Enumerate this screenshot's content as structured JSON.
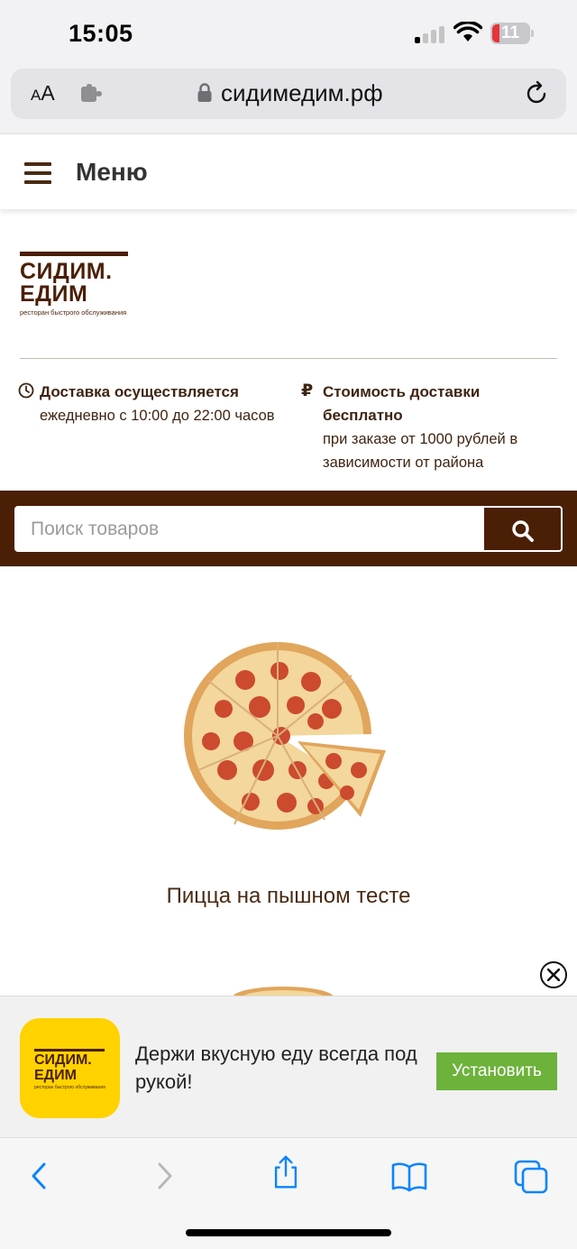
{
  "status_bar": {
    "time": "15:05",
    "battery_level": "11",
    "signal_bars_active": 1,
    "icons": [
      "cellular-signal-icon",
      "wifi-icon",
      "battery-icon"
    ]
  },
  "browser": {
    "text_size_label": "AA",
    "url": "сидимедим.рф",
    "icons": [
      "puzzle-icon",
      "lock-icon",
      "reload-icon"
    ]
  },
  "site_header": {
    "menu_label": "Меню",
    "icons": [
      "hamburger-icon"
    ]
  },
  "logo": {
    "line1": "СИДИМ.",
    "line2": "ЕДИМ",
    "tagline": "ресторан быстрого обслуживания"
  },
  "delivery_info": {
    "title": "Доставка осуществляется",
    "text": "ежедневно с 10:00 до 22:00 часов",
    "icon": "clock-icon"
  },
  "price_info": {
    "symbol": "₽",
    "title": "Стоимость доставки бесплатно",
    "text": "при заказе от 1000 рублей в зависимости от района"
  },
  "search": {
    "placeholder": "Поиск товаров",
    "icon": "search-icon"
  },
  "product": {
    "title": "Пицца на пышном тесте",
    "image": "pepperoni-pizza"
  },
  "app_banner": {
    "icon_line1": "СИДИМ.",
    "icon_line2": "ЕДИМ",
    "icon_tagline": "ресторан быстрого обслуживания",
    "text": "Держи вкусную еду всегда под рукой!",
    "install_label": "Установить",
    "close_icon": "close-icon"
  },
  "toolbar": {
    "icons": [
      "back-icon",
      "forward-icon",
      "share-icon",
      "bookmarks-icon",
      "tabs-icon"
    ]
  },
  "colors": {
    "brand_brown": "#4a1f05",
    "install_green": "#6cb23b",
    "app_icon_yellow": "#ffd200",
    "ios_blue": "#0a84ff"
  }
}
